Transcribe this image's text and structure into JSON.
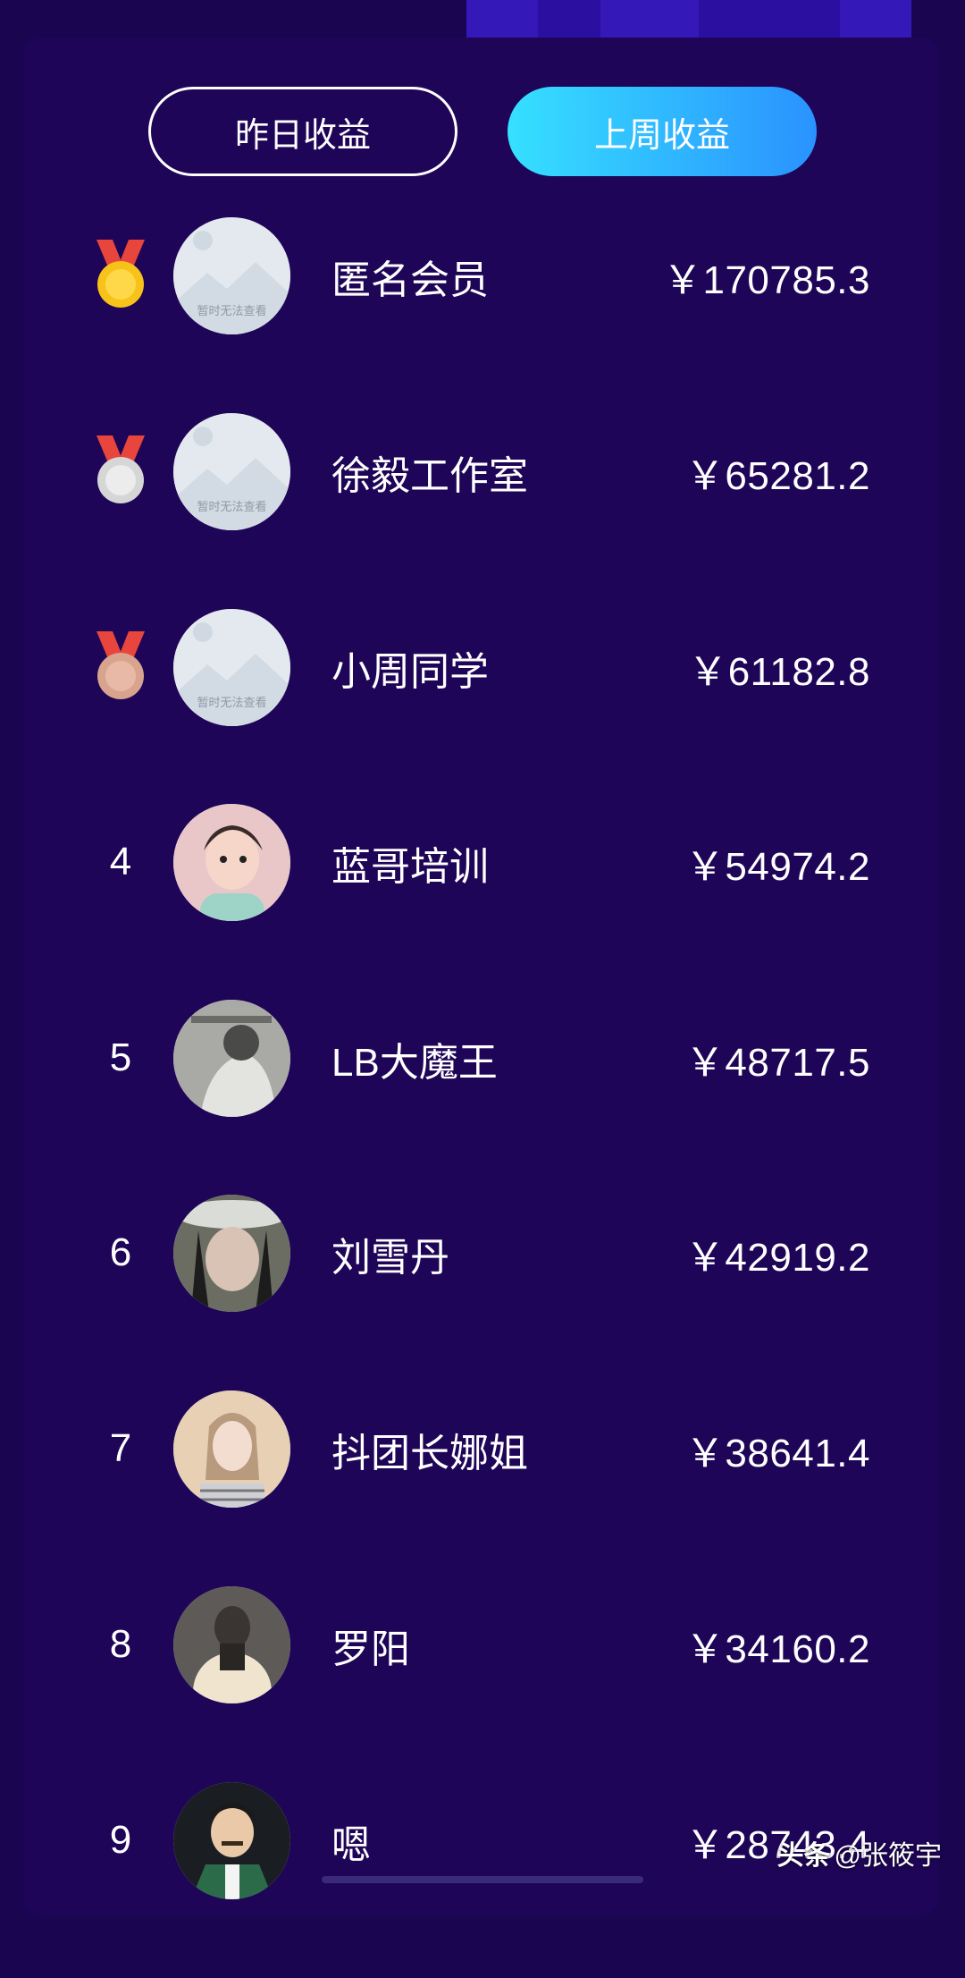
{
  "tabs": [
    {
      "label": "昨日收益",
      "active": false
    },
    {
      "label": "上周收益",
      "active": true
    }
  ],
  "ranking": [
    {
      "rank": "1",
      "medal": "gold-medal",
      "avatar": "placeholder-image",
      "avatar_caption": "暂时无法查看",
      "name": "匿名会员",
      "amount": "￥170785.3"
    },
    {
      "rank": "2",
      "medal": "silver-medal",
      "avatar": "placeholder-image",
      "avatar_caption": "暂时无法查看",
      "name": "徐毅工作室",
      "amount": "￥65281.2"
    },
    {
      "rank": "3",
      "medal": "bronze-medal",
      "avatar": "placeholder-image",
      "avatar_caption": "暂时无法查看",
      "name": "小周同学",
      "amount": "￥61182.8"
    },
    {
      "rank": "4",
      "avatar": "child-photo",
      "name": "蓝哥培训",
      "amount": "￥54974.2"
    },
    {
      "rank": "5",
      "avatar": "gray-photo",
      "name": "LB大魔王",
      "amount": "￥48717.5"
    },
    {
      "rank": "6",
      "avatar": "hat-photo",
      "name": "刘雪丹",
      "amount": "￥42919.2"
    },
    {
      "rank": "7",
      "avatar": "woman-photo",
      "name": "抖团长娜姐",
      "amount": "￥38641.4"
    },
    {
      "rank": "8",
      "avatar": "dark-photo",
      "name": "罗阳",
      "amount": "￥34160.2"
    },
    {
      "rank": "9",
      "avatar": "cartoon-man",
      "name": "嗯",
      "amount": "￥28743.4"
    }
  ],
  "watermark": {
    "brand": "头条",
    "handle": "@张筱宇"
  },
  "colors": {
    "background": "#1a0550",
    "card": "#1e0557",
    "tab_active_start": "#36e0ff",
    "tab_active_end": "#2a92ff",
    "gold": "#f7c21a",
    "silver": "#d6d6d6",
    "bronze": "#d9a48e",
    "ribbon": "#e8453c"
  }
}
